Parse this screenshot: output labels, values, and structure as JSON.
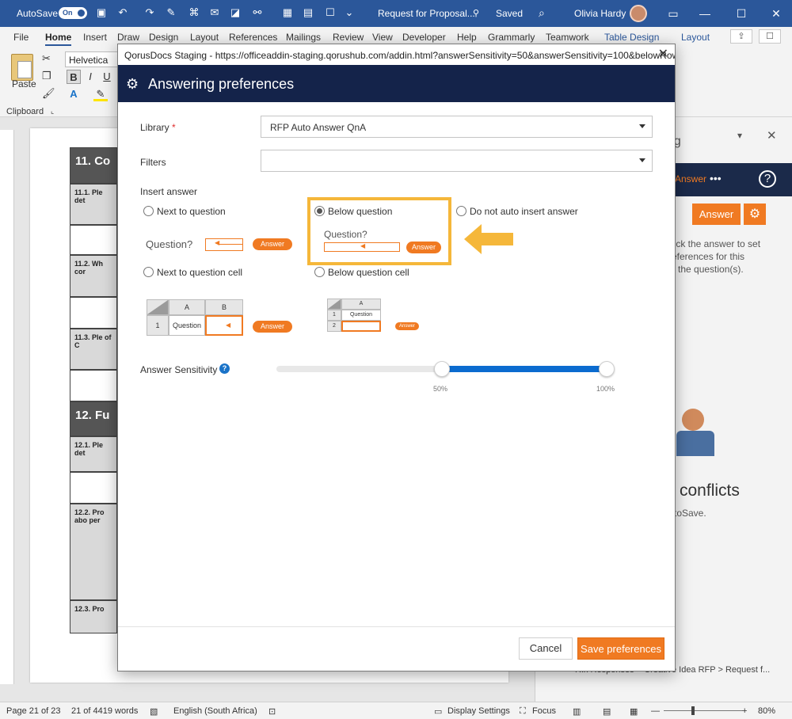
{
  "word": {
    "autosave_label": "AutoSave",
    "autosave_state": "On",
    "doc_title": "Request for Proposal...",
    "save_state": "Saved",
    "user_name": "Olivia Hardy",
    "tabs": [
      "File",
      "Home",
      "Insert",
      "Draw",
      "Design",
      "Layout",
      "References",
      "Mailings",
      "Review",
      "View",
      "Developer",
      "Help",
      "Grammarly",
      "Teamwork"
    ],
    "context_tabs": [
      "Table Design",
      "Layout"
    ],
    "active_tab": "Home",
    "font_name": "Helvetica",
    "paste_label": "Paste",
    "clipboard_label": "Clipboard",
    "format_buttons": [
      "B",
      "I",
      "U"
    ]
  },
  "document": {
    "sections": [
      {
        "num": "11.",
        "title": "Co"
      },
      {
        "num": "12.",
        "title": "Fu"
      }
    ],
    "rows": [
      {
        "num": "11.1.",
        "text": "Ple det"
      },
      {
        "num": "11.2.",
        "text": "Wh cor"
      },
      {
        "num": "11.3.",
        "text": "Ple of C"
      },
      {
        "num": "12.1.",
        "text": "Ple det"
      },
      {
        "num": "12.2.",
        "text": "Pro abo per"
      },
      {
        "num": "12.3.",
        "text": "Pro"
      }
    ]
  },
  "pane": {
    "title_fragment": "ng",
    "answer_link": "Answer",
    "answer_button": "Answer",
    "info_text_1": "lick the answer to set",
    "info_text_2": "eferences for this",
    "info_text_3": "the question(s).",
    "conflicts": "conflicts",
    "autosave_text": "toSave.",
    "breadcrumb": "Rfx Responses > Creative Idea RFP > Request f..."
  },
  "status": {
    "page": "Page 21 of 23",
    "words": "21 of 4419 words",
    "language": "English (South Africa)",
    "display_settings": "Display Settings",
    "focus": "Focus",
    "zoom": "80%"
  },
  "dialog": {
    "window_title": "QorusDocs Staging - https://officeaddin-staging.qorushub.com/addin.html?answerSensitivity=50&answerSensitivity=100&belowRow...",
    "header": "Answering preferences",
    "library_label": "Library",
    "library_required": "*",
    "library_value": "RFP Auto Answer QnA",
    "filters_label": "Filters",
    "filters_value": "",
    "insert_answer_label": "Insert answer",
    "options": {
      "next_to_question": "Next to question",
      "below_question": "Below question",
      "do_not_auto_insert": "Do not auto insert answer",
      "next_to_question_cell": "Next to question cell",
      "below_question_cell": "Below question cell"
    },
    "selected_option": "below_question",
    "illustration": {
      "question": "Question?",
      "answer": "Answer",
      "col_a": "A",
      "col_b": "B",
      "row_1": "1",
      "row_2": "2",
      "cell_question": "Question"
    },
    "sensitivity_label": "Answer Sensitivity",
    "sensitivity_min_pct": 50,
    "sensitivity_max_pct": 100,
    "tick_min": "50%",
    "tick_max": "100%",
    "cancel": "Cancel",
    "save": "Save preferences"
  },
  "colors": {
    "word_blue": "#2b579a",
    "dialog_header": "#14234a",
    "accent_orange": "#f07a22",
    "highlight_yellow": "#f5b73a",
    "slider_blue": "#0b6bcf"
  }
}
